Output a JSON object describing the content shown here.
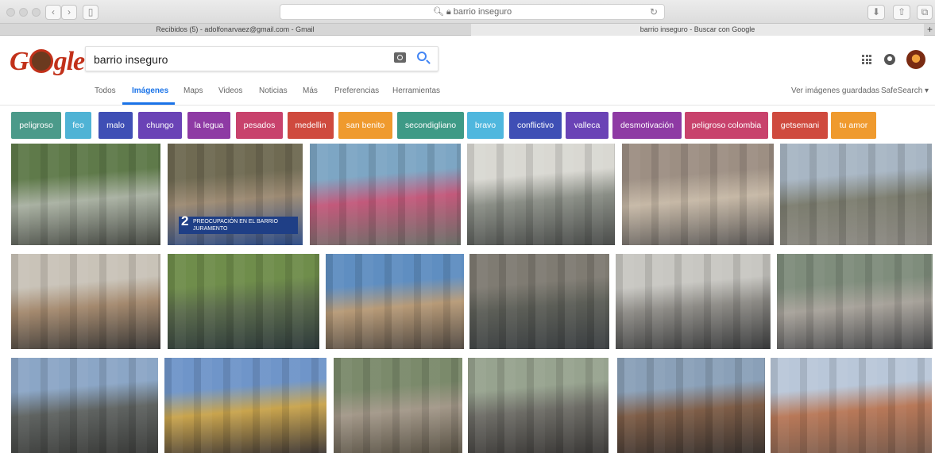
{
  "browser": {
    "url": "barrio inseguro",
    "tabs": [
      "Recibidos (5) - adolfonarvaez@gmail.com - Gmail",
      "barrio inseguro - Buscar con Google"
    ]
  },
  "search": {
    "logo": "Google",
    "query": "barrio inseguro"
  },
  "nav": {
    "items": [
      "Todos",
      "Imágenes",
      "Maps",
      "Videos",
      "Noticias",
      "Más",
      "Preferencias",
      "Herramientas"
    ],
    "selected": "Imágenes",
    "saved": "Ver imágenes guardadas",
    "safesearch": "SafeSearch ▾"
  },
  "chips": [
    {
      "label": "peligroso",
      "color": "#4b9a8a"
    },
    {
      "label": "feo",
      "color": "#4fb3d5"
    },
    {
      "label": "malo",
      "color": "#3f4fb5"
    },
    {
      "label": "chungo",
      "color": "#6a43b6"
    },
    {
      "label": "la legua",
      "color": "#8e3aa4"
    },
    {
      "label": "pesados",
      "color": "#c8426c"
    },
    {
      "label": "medellin",
      "color": "#cf4a3e"
    },
    {
      "label": "san benito",
      "color": "#ef9a2e"
    },
    {
      "label": "secondigliano",
      "color": "#3e9a86"
    },
    {
      "label": "bravo",
      "color": "#4fb7de"
    },
    {
      "label": "conflictivo",
      "color": "#3f4fb5"
    },
    {
      "label": "valleca",
      "color": "#6a43b6"
    },
    {
      "label": "desmotivación",
      "color": "#8e3aa4"
    },
    {
      "label": "peligroso colombia",
      "color": "#c8426c"
    },
    {
      "label": "getsemani",
      "color": "#cf4a3e"
    },
    {
      "label": "tu amor",
      "color": "#ef9a2e"
    }
  ],
  "results": [
    {
      "name": "street-trees",
      "colors": [
        "#5f7a4a",
        "#a9b1a2",
        "#474a44"
      ]
    },
    {
      "name": "news-broadcast",
      "caption": "2",
      "subcaption": "PREOCUPACIÓN EN EL BARRIO JURAMENTO",
      "colors": [
        "#6f6a52",
        "#9c8a73",
        "#2b4a85"
      ]
    },
    {
      "name": "graffiti-street",
      "colors": [
        "#7da6c4",
        "#c3597b",
        "#6a6f68"
      ]
    },
    {
      "name": "white-houses",
      "colors": [
        "#d9d8d2",
        "#8a8e86",
        "#4b4d4b"
      ]
    },
    {
      "name": "graffiti-alley",
      "colors": [
        "#9d8f83",
        "#c6b8a6",
        "#5d5a58"
      ]
    },
    {
      "name": "industrial-road",
      "colors": [
        "#a8b6c4",
        "#7c7d6f",
        "#8d8a84"
      ]
    },
    {
      "name": "trucks",
      "colors": [
        "#c9c3b8",
        "#a4896e",
        "#3d3b39"
      ]
    },
    {
      "name": "people-park",
      "colors": [
        "#6f8d4b",
        "#5a6a4c",
        "#2f3b3c"
      ]
    },
    {
      "name": "balconies",
      "colors": [
        "#5f8ec1",
        "#b79a77",
        "#524a43"
      ]
    },
    {
      "name": "courtyard",
      "colors": [
        "#7f7b72",
        "#5c5e57",
        "#3b3f42"
      ]
    },
    {
      "name": "monument-square",
      "colors": [
        "#c8c7c2",
        "#8c8a85",
        "#3d3e3f"
      ]
    },
    {
      "name": "collage-street",
      "colors": [
        "#7f8d7c",
        "#a7a29a",
        "#4b4c4e"
      ]
    },
    {
      "name": "kiosk",
      "colors": [
        "#8ba6c6",
        "#5f6361",
        "#3b3c3a"
      ]
    },
    {
      "name": "yellow-buildings",
      "colors": [
        "#6f95c9",
        "#c9a44d",
        "#403935"
      ]
    },
    {
      "name": "people-sitting",
      "colors": [
        "#7b8a6b",
        "#a39889",
        "#5a5346"
      ]
    },
    {
      "name": "benches",
      "colors": [
        "#97a38f",
        "#6d6c66",
        "#3c3a38"
      ]
    },
    {
      "name": "wires-street",
      "colors": [
        "#8aa0b8",
        "#7e5d47",
        "#3b3430"
      ]
    },
    {
      "name": "hillside-favela",
      "colors": [
        "#b9c7d9",
        "#b87858",
        "#7a5d4e"
      ]
    }
  ]
}
